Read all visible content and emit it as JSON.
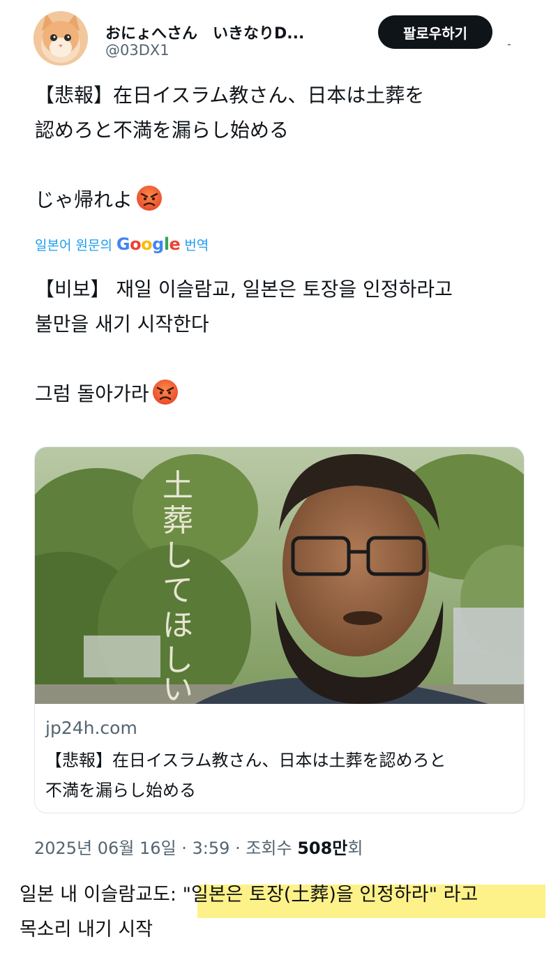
{
  "tweet": {
    "display_name": "おにょへさん　いきなりD...",
    "handle": "@03DX1",
    "follow_label": "팔로우하기",
    "text_jp_line1": "【悲報】在日イスラム教さん、日本は土葬を",
    "text_jp_line2": "認めろと不満を漏らし始める",
    "text_jp_line3": "じゃ帰れよ",
    "translate_prefix": "일본어 원문의",
    "translate_suffix": "번역",
    "google_letters": [
      "G",
      "o",
      "o",
      "g",
      "l",
      "e"
    ],
    "text_ko_line1": "【비보】 재일 이슬람교, 일본은 토장을 인정하라고",
    "text_ko_line2": "불만을 새기 시작한다",
    "text_ko_line3": "그럼 돌아가라",
    "card": {
      "image_caption": "土葬してほしい",
      "image_caption_chars": [
        "土",
        "葬",
        "し",
        "て",
        "ほ",
        "し",
        "い"
      ],
      "domain": "jp24h.com",
      "title_line1": "【悲報】在日イスラム教さん、日本は土葬を認めろと",
      "title_line2": "不満を漏らし始める"
    },
    "meta_date": "2025년 06월 16일 · 3:59 · 조회수 ",
    "meta_views": "508만",
    "meta_suffix": "회"
  },
  "caption": {
    "line1_prefix": "일본 내 이슬람교도: ",
    "line1_quote": "\"일본은 토장(土葬)을 인정하라\" 라고",
    "line2": "목소리 내기 시작"
  },
  "colors": {
    "link_blue": "#1d9bf0",
    "follow_bg": "#0f1419",
    "highlight": "#fdf28a",
    "muted": "#536471"
  },
  "icons": {
    "angry_emoji": "angry-face-icon",
    "avatar": "kitten-avatar"
  }
}
